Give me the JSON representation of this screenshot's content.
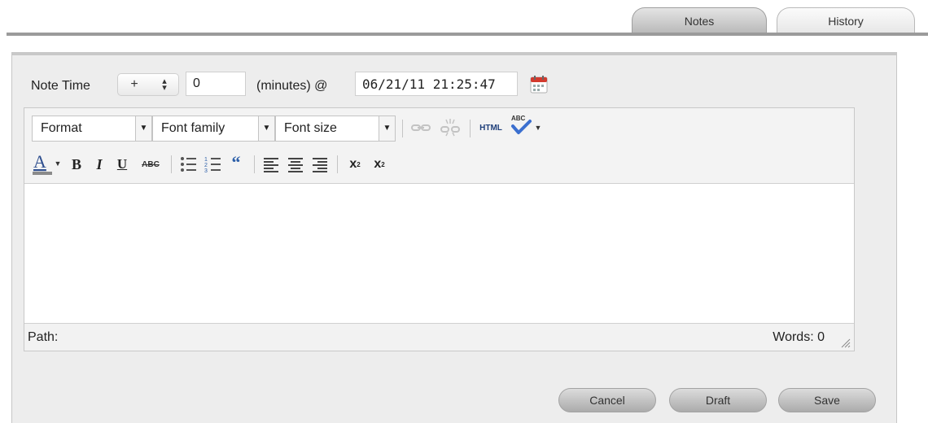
{
  "tabs": [
    {
      "label": "Notes",
      "active": true
    },
    {
      "label": "History",
      "active": false
    }
  ],
  "note_time": {
    "label": "Note Time",
    "sign": "+",
    "minutes_value": "0",
    "minutes_label": "(minutes) @",
    "datetime_value": "06/21/11 21:25:47"
  },
  "editor": {
    "toolbar": {
      "format_label": "Format",
      "font_family_label": "Font family",
      "font_size_label": "Font size",
      "html_label": "HTML",
      "icons_row1": [
        "link-icon",
        "unlink-icon",
        "html-source-icon",
        "spellcheck-icon"
      ],
      "icons_row2": [
        "text-color-icon",
        "bold-icon",
        "italic-icon",
        "underline-icon",
        "strikethrough-icon",
        "bullet-list-icon",
        "numbered-list-icon",
        "blockquote-icon",
        "align-left-icon",
        "align-center-icon",
        "align-right-icon",
        "subscript-icon",
        "superscript-icon"
      ]
    },
    "path_label": "Path:",
    "words_label": "Words: 0"
  },
  "actions": {
    "cancel_label": "Cancel",
    "draft_label": "Draft",
    "save_label": "Save"
  },
  "colors": {
    "panel_bg": "#ededed",
    "tab_bar": "#9b9b9b",
    "text_color_underline": "#8a8a8a",
    "blockquote": "#2b5ea8",
    "spellcheck": "#3b6fcf"
  }
}
